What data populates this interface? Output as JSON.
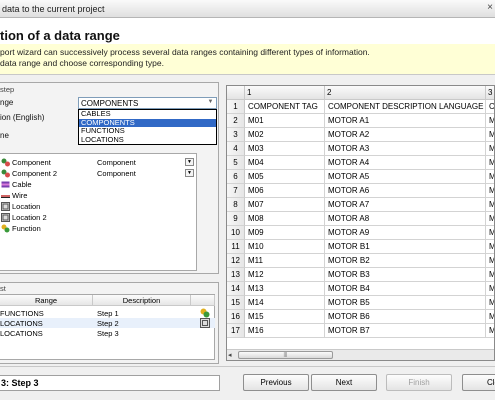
{
  "window": {
    "title": "data to the current project",
    "close_glyph": "×"
  },
  "header": {
    "heading": "tion of a data range",
    "desc_line1": "port wizard can successively process several data ranges containing different types of information.",
    "desc_line2": "data range and choose corresponding type."
  },
  "step_group": {
    "group_label": "step",
    "range_label": "nge",
    "description_label": "ion (English)",
    "type_label": "ne",
    "combo_value": "COMPONENTS",
    "dropdown_options": [
      "CABLES",
      "COMPONENTS",
      "FUNCTIONS",
      "LOCATIONS"
    ],
    "dropdown_selected": "COMPONENTS"
  },
  "tree": [
    {
      "name": "Component",
      "value": "Component",
      "icon": "component-icon"
    },
    {
      "name": "Component 2",
      "value": "Component",
      "icon": "component-icon"
    },
    {
      "name": "Cable",
      "value": "",
      "icon": "cable-icon"
    },
    {
      "name": "Wire",
      "value": "",
      "icon": "wire-icon"
    },
    {
      "name": "Location",
      "value": "",
      "icon": "location-icon"
    },
    {
      "name": "Location 2",
      "value": "",
      "icon": "location-icon"
    },
    {
      "name": "Function",
      "value": "",
      "icon": "function-icon"
    }
  ],
  "list_group": {
    "group_label": "st",
    "col_range": "Range",
    "col_description": "Description",
    "rows": [
      {
        "range": "FUNCTIONS",
        "desc": "Step 1",
        "icon": "function-icon"
      },
      {
        "range": "LOCATIONS",
        "desc": "Step 2",
        "icon": "location-icon"
      },
      {
        "range": "LOCATIONS",
        "desc": "Step 3",
        "icon": ""
      }
    ]
  },
  "grid": {
    "col_headers": [
      "1",
      "2",
      "3"
    ],
    "row_numbers": [
      "1",
      "2",
      "3",
      "4",
      "5",
      "6",
      "7",
      "8",
      "9",
      "10",
      "11",
      "12",
      "13",
      "14",
      "15",
      "16",
      "17"
    ],
    "col1": [
      "COMPONENT TAG",
      "M01",
      "M02",
      "M03",
      "M04",
      "M05",
      "M06",
      "M07",
      "M08",
      "M09",
      "M10",
      "M11",
      "M12",
      "M13",
      "M14",
      "M15",
      "M16"
    ],
    "col2": [
      "COMPONENT DESCRIPTION LANGUAGE 1",
      "MOTOR A1",
      "MOTOR A2",
      "MOTOR A3",
      "MOTOR A4",
      "MOTOR A5",
      "MOTOR A6",
      "MOTOR A7",
      "MOTOR A8",
      "MOTOR A9",
      "MOTOR B1",
      "MOTOR B2",
      "MOTOR B3",
      "MOTOR B4",
      "MOTOR B5",
      "MOTOR B6",
      "MOTOR B7"
    ],
    "col3": [
      "CO",
      "M",
      "M",
      "M",
      "M",
      "M",
      "M",
      "M",
      "M",
      "M",
      "M",
      "M",
      "M",
      "M",
      "M",
      "M",
      "M"
    ]
  },
  "footer": {
    "step_indicator": "3: Step 3",
    "previous": "Previous",
    "next": "Next",
    "finish": "Finish",
    "close": "Clo"
  }
}
